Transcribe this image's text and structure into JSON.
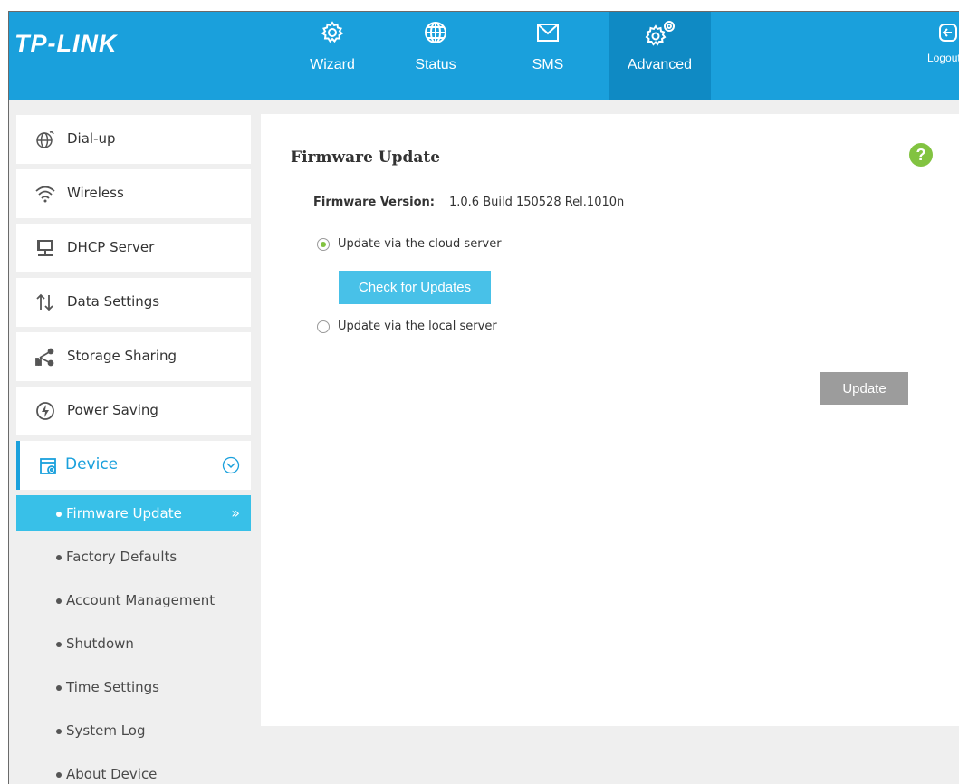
{
  "header": {
    "logo": "TP-LINK",
    "nav": [
      {
        "label": "Wizard",
        "icon": "gear-icon"
      },
      {
        "label": "Status",
        "icon": "globe-icon"
      },
      {
        "label": "SMS",
        "icon": "envelope-icon"
      },
      {
        "label": "Advanced",
        "icon": "gears-icon",
        "active": true
      }
    ],
    "logout": "Logout"
  },
  "sidebar": {
    "items": [
      {
        "label": "Dial-up",
        "icon": "globe-icon"
      },
      {
        "label": "Wireless",
        "icon": "wifi-icon"
      },
      {
        "label": "DHCP Server",
        "icon": "server-icon"
      },
      {
        "label": "Data Settings",
        "icon": "arrows-updown-icon"
      },
      {
        "label": "Storage Sharing",
        "icon": "share-icon"
      },
      {
        "label": "Power Saving",
        "icon": "power-icon"
      },
      {
        "label": "Device",
        "icon": "device-settings-icon",
        "expanded": true
      }
    ],
    "device_sub": [
      {
        "label": "Firmware Update",
        "active": true
      },
      {
        "label": "Factory Defaults"
      },
      {
        "label": "Account Management"
      },
      {
        "label": "Shutdown"
      },
      {
        "label": "Time Settings"
      },
      {
        "label": "System Log"
      },
      {
        "label": "About Device"
      }
    ]
  },
  "main": {
    "title": "Firmware Update",
    "help": "?",
    "firmware_label": "Firmware Version:",
    "firmware_value": "1.0.6 Build 150528 Rel.1010n",
    "option_cloud": "Update via the cloud server",
    "option_local": "Update via the local server",
    "selected_option": "cloud",
    "check_button": "Check for Updates",
    "update_button": "Update"
  },
  "colors": {
    "header_bg": "#1aa0dc",
    "header_active": "#0f8ac4",
    "sub_active": "#38c0e8",
    "radio_check": "#82c341",
    "help_bg": "#82c341",
    "update_button": "#9c9c9c"
  }
}
